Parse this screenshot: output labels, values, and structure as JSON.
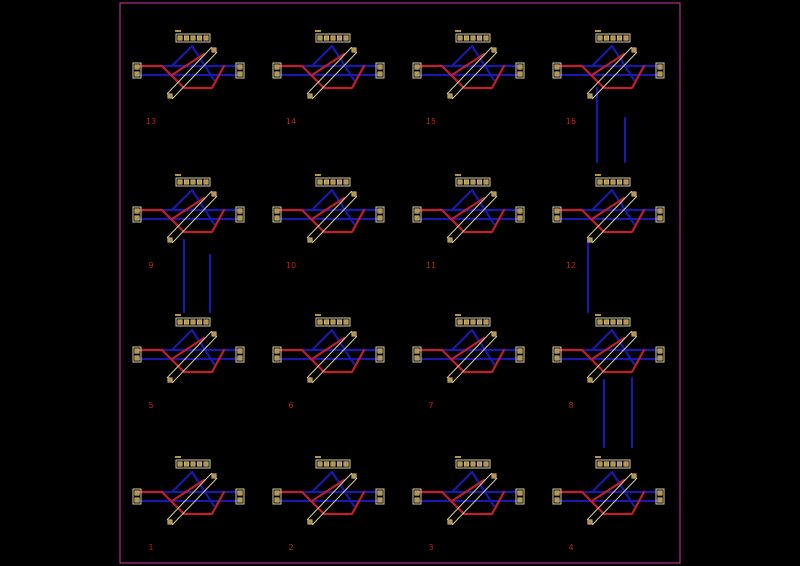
{
  "colors": {
    "background": "#000000",
    "outline": "#b0308c",
    "trace_blue": "#1a1aa8",
    "trace_red": "#c0202a",
    "silk": "#d8d0a0",
    "pad": "#b89048",
    "label": "#c02020"
  },
  "cells": [
    {
      "label": "13"
    },
    {
      "label": "14"
    },
    {
      "label": "15"
    },
    {
      "label": "16"
    },
    {
      "label": "9"
    },
    {
      "label": "10"
    },
    {
      "label": "11"
    },
    {
      "label": "12"
    },
    {
      "label": "5"
    },
    {
      "label": "6"
    },
    {
      "label": "7"
    },
    {
      "label": "8"
    },
    {
      "label": "1"
    },
    {
      "label": "2"
    },
    {
      "label": "3"
    },
    {
      "label": "4"
    }
  ]
}
